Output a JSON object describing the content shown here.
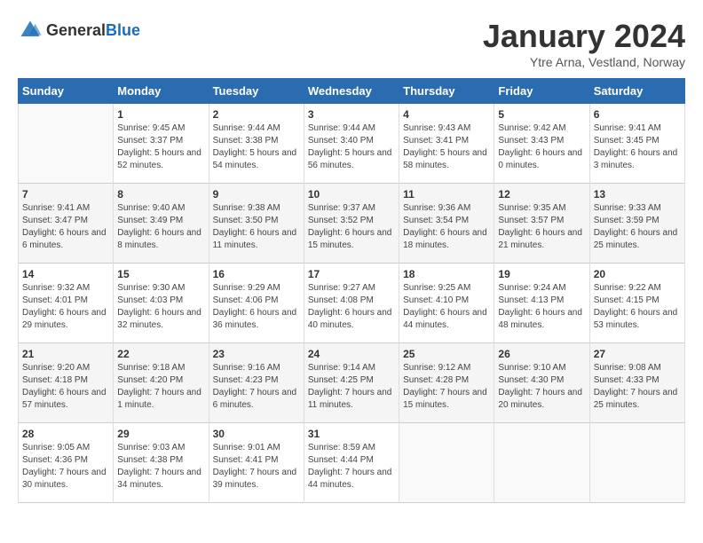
{
  "header": {
    "logo_general": "General",
    "logo_blue": "Blue",
    "month_title": "January 2024",
    "subtitle": "Ytre Arna, Vestland, Norway"
  },
  "days_of_week": [
    "Sunday",
    "Monday",
    "Tuesday",
    "Wednesday",
    "Thursday",
    "Friday",
    "Saturday"
  ],
  "weeks": [
    [
      {
        "day": "",
        "sunrise": "",
        "sunset": "",
        "daylight": ""
      },
      {
        "day": "1",
        "sunrise": "Sunrise: 9:45 AM",
        "sunset": "Sunset: 3:37 PM",
        "daylight": "Daylight: 5 hours and 52 minutes."
      },
      {
        "day": "2",
        "sunrise": "Sunrise: 9:44 AM",
        "sunset": "Sunset: 3:38 PM",
        "daylight": "Daylight: 5 hours and 54 minutes."
      },
      {
        "day": "3",
        "sunrise": "Sunrise: 9:44 AM",
        "sunset": "Sunset: 3:40 PM",
        "daylight": "Daylight: 5 hours and 56 minutes."
      },
      {
        "day": "4",
        "sunrise": "Sunrise: 9:43 AM",
        "sunset": "Sunset: 3:41 PM",
        "daylight": "Daylight: 5 hours and 58 minutes."
      },
      {
        "day": "5",
        "sunrise": "Sunrise: 9:42 AM",
        "sunset": "Sunset: 3:43 PM",
        "daylight": "Daylight: 6 hours and 0 minutes."
      },
      {
        "day": "6",
        "sunrise": "Sunrise: 9:41 AM",
        "sunset": "Sunset: 3:45 PM",
        "daylight": "Daylight: 6 hours and 3 minutes."
      }
    ],
    [
      {
        "day": "7",
        "sunrise": "Sunrise: 9:41 AM",
        "sunset": "Sunset: 3:47 PM",
        "daylight": "Daylight: 6 hours and 6 minutes."
      },
      {
        "day": "8",
        "sunrise": "Sunrise: 9:40 AM",
        "sunset": "Sunset: 3:49 PM",
        "daylight": "Daylight: 6 hours and 8 minutes."
      },
      {
        "day": "9",
        "sunrise": "Sunrise: 9:38 AM",
        "sunset": "Sunset: 3:50 PM",
        "daylight": "Daylight: 6 hours and 11 minutes."
      },
      {
        "day": "10",
        "sunrise": "Sunrise: 9:37 AM",
        "sunset": "Sunset: 3:52 PM",
        "daylight": "Daylight: 6 hours and 15 minutes."
      },
      {
        "day": "11",
        "sunrise": "Sunrise: 9:36 AM",
        "sunset": "Sunset: 3:54 PM",
        "daylight": "Daylight: 6 hours and 18 minutes."
      },
      {
        "day": "12",
        "sunrise": "Sunrise: 9:35 AM",
        "sunset": "Sunset: 3:57 PM",
        "daylight": "Daylight: 6 hours and 21 minutes."
      },
      {
        "day": "13",
        "sunrise": "Sunrise: 9:33 AM",
        "sunset": "Sunset: 3:59 PM",
        "daylight": "Daylight: 6 hours and 25 minutes."
      }
    ],
    [
      {
        "day": "14",
        "sunrise": "Sunrise: 9:32 AM",
        "sunset": "Sunset: 4:01 PM",
        "daylight": "Daylight: 6 hours and 29 minutes."
      },
      {
        "day": "15",
        "sunrise": "Sunrise: 9:30 AM",
        "sunset": "Sunset: 4:03 PM",
        "daylight": "Daylight: 6 hours and 32 minutes."
      },
      {
        "day": "16",
        "sunrise": "Sunrise: 9:29 AM",
        "sunset": "Sunset: 4:06 PM",
        "daylight": "Daylight: 6 hours and 36 minutes."
      },
      {
        "day": "17",
        "sunrise": "Sunrise: 9:27 AM",
        "sunset": "Sunset: 4:08 PM",
        "daylight": "Daylight: 6 hours and 40 minutes."
      },
      {
        "day": "18",
        "sunrise": "Sunrise: 9:25 AM",
        "sunset": "Sunset: 4:10 PM",
        "daylight": "Daylight: 6 hours and 44 minutes."
      },
      {
        "day": "19",
        "sunrise": "Sunrise: 9:24 AM",
        "sunset": "Sunset: 4:13 PM",
        "daylight": "Daylight: 6 hours and 48 minutes."
      },
      {
        "day": "20",
        "sunrise": "Sunrise: 9:22 AM",
        "sunset": "Sunset: 4:15 PM",
        "daylight": "Daylight: 6 hours and 53 minutes."
      }
    ],
    [
      {
        "day": "21",
        "sunrise": "Sunrise: 9:20 AM",
        "sunset": "Sunset: 4:18 PM",
        "daylight": "Daylight: 6 hours and 57 minutes."
      },
      {
        "day": "22",
        "sunrise": "Sunrise: 9:18 AM",
        "sunset": "Sunset: 4:20 PM",
        "daylight": "Daylight: 7 hours and 1 minute."
      },
      {
        "day": "23",
        "sunrise": "Sunrise: 9:16 AM",
        "sunset": "Sunset: 4:23 PM",
        "daylight": "Daylight: 7 hours and 6 minutes."
      },
      {
        "day": "24",
        "sunrise": "Sunrise: 9:14 AM",
        "sunset": "Sunset: 4:25 PM",
        "daylight": "Daylight: 7 hours and 11 minutes."
      },
      {
        "day": "25",
        "sunrise": "Sunrise: 9:12 AM",
        "sunset": "Sunset: 4:28 PM",
        "daylight": "Daylight: 7 hours and 15 minutes."
      },
      {
        "day": "26",
        "sunrise": "Sunrise: 9:10 AM",
        "sunset": "Sunset: 4:30 PM",
        "daylight": "Daylight: 7 hours and 20 minutes."
      },
      {
        "day": "27",
        "sunrise": "Sunrise: 9:08 AM",
        "sunset": "Sunset: 4:33 PM",
        "daylight": "Daylight: 7 hours and 25 minutes."
      }
    ],
    [
      {
        "day": "28",
        "sunrise": "Sunrise: 9:05 AM",
        "sunset": "Sunset: 4:36 PM",
        "daylight": "Daylight: 7 hours and 30 minutes."
      },
      {
        "day": "29",
        "sunrise": "Sunrise: 9:03 AM",
        "sunset": "Sunset: 4:38 PM",
        "daylight": "Daylight: 7 hours and 34 minutes."
      },
      {
        "day": "30",
        "sunrise": "Sunrise: 9:01 AM",
        "sunset": "Sunset: 4:41 PM",
        "daylight": "Daylight: 7 hours and 39 minutes."
      },
      {
        "day": "31",
        "sunrise": "Sunrise: 8:59 AM",
        "sunset": "Sunset: 4:44 PM",
        "daylight": "Daylight: 7 hours and 44 minutes."
      },
      {
        "day": "",
        "sunrise": "",
        "sunset": "",
        "daylight": ""
      },
      {
        "day": "",
        "sunrise": "",
        "sunset": "",
        "daylight": ""
      },
      {
        "day": "",
        "sunrise": "",
        "sunset": "",
        "daylight": ""
      }
    ]
  ]
}
